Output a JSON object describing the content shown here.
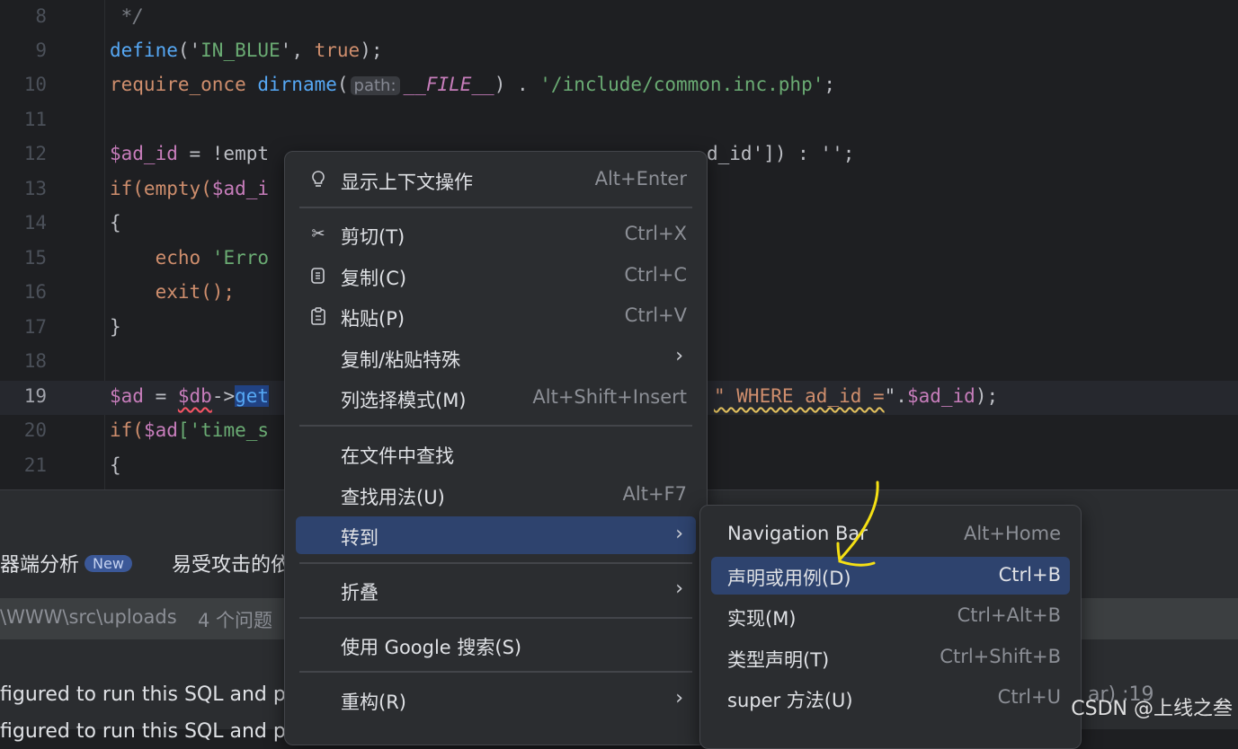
{
  "editor": {
    "lines": [
      {
        "num": "8"
      },
      {
        "num": "9"
      },
      {
        "num": "10"
      },
      {
        "num": "11"
      },
      {
        "num": "12"
      },
      {
        "num": "13"
      },
      {
        "num": "14"
      },
      {
        "num": "15"
      },
      {
        "num": "16"
      },
      {
        "num": "17"
      },
      {
        "num": "18"
      },
      {
        "num": "19"
      },
      {
        "num": "20"
      },
      {
        "num": "21"
      }
    ],
    "code": {
      "l8": " */",
      "l9_fn": "define",
      "l9_a": "('",
      "l9_s": "IN_BLUE",
      "l9_b": "', ",
      "l9_k": "true",
      "l9_c": ");",
      "l10_k": "require_once",
      "l10_fn": "dirname",
      "l10_hint": "path:",
      "l10_const": "__FILE__",
      "l10_s": "'/include/common.inc.php'",
      "l12_var": "$ad_id",
      "l12_a": " = !empt",
      "l12_b": "d_id']) : '';",
      "l13_k": "if(empty(",
      "l13_var": "$ad_i",
      "l14": "{",
      "l15_k": "echo",
      "l15_s": "'Erro",
      "l16": "exit();",
      "l17": "}",
      "l19_var": "$ad",
      "l19_a": " = ",
      "l19_db": "$db",
      "l19_arrow": "->",
      "l19_sel": "get",
      "l19_where": "\" WHERE ad_id =",
      "l19_end": "\".",
      "l19_var2": "$ad_id",
      "l19_close": ");",
      "l20_k": "if(",
      "l20_var": "$ad",
      "l20_s": "['time_s",
      "l21": "{"
    }
  },
  "bottom_panel": {
    "tab1": "器端分析",
    "tab1_badge": "New",
    "tab2": "易受攻击的依",
    "path": "\\WWW\\src\\uploads",
    "path_count": "4 个问题",
    "result1": "figured to run this SQL and pr",
    "result1_tail": "ar) :19",
    "result2": "figured to run this SQL and pr"
  },
  "context_menu": {
    "items": [
      {
        "label": "显示上下文操作",
        "shortcut": "Alt+Enter",
        "icon": "lightbulb-icon"
      },
      {
        "label": "剪切(T)",
        "shortcut": "Ctrl+X",
        "icon": "scissors-icon"
      },
      {
        "label": "复制(C)",
        "shortcut": "Ctrl+C",
        "icon": "copy-icon"
      },
      {
        "label": "粘贴(P)",
        "shortcut": "Ctrl+V",
        "icon": "paste-icon"
      },
      {
        "label": "复制/粘贴特殊",
        "shortcut": ""
      },
      {
        "label": "列选择模式(M)",
        "shortcut": "Alt+Shift+Insert"
      },
      {
        "label": "在文件中查找",
        "shortcut": ""
      },
      {
        "label": "查找用法(U)",
        "shortcut": "Alt+F7"
      },
      {
        "label": "转到",
        "shortcut": "",
        "highlighted": true
      },
      {
        "label": "折叠",
        "shortcut": ""
      },
      {
        "label": "使用 Google 搜索(S)",
        "shortcut": ""
      },
      {
        "label": "重构(R)",
        "shortcut": ""
      }
    ]
  },
  "submenu": {
    "items": [
      {
        "label": "Navigation Bar",
        "shortcut": "Alt+Home"
      },
      {
        "label": "声明或用例(D)",
        "shortcut": "Ctrl+B",
        "highlighted": true
      },
      {
        "label": "实现(M)",
        "shortcut": "Ctrl+Alt+B"
      },
      {
        "label": "类型声明(T)",
        "shortcut": "Ctrl+Shift+B"
      },
      {
        "label": "super 方法(U)",
        "shortcut": "Ctrl+U"
      }
    ]
  },
  "watermark": "CSDN @上线之叁",
  "colors": {
    "accent": "#2e436e",
    "annotation": "#f5e014"
  }
}
